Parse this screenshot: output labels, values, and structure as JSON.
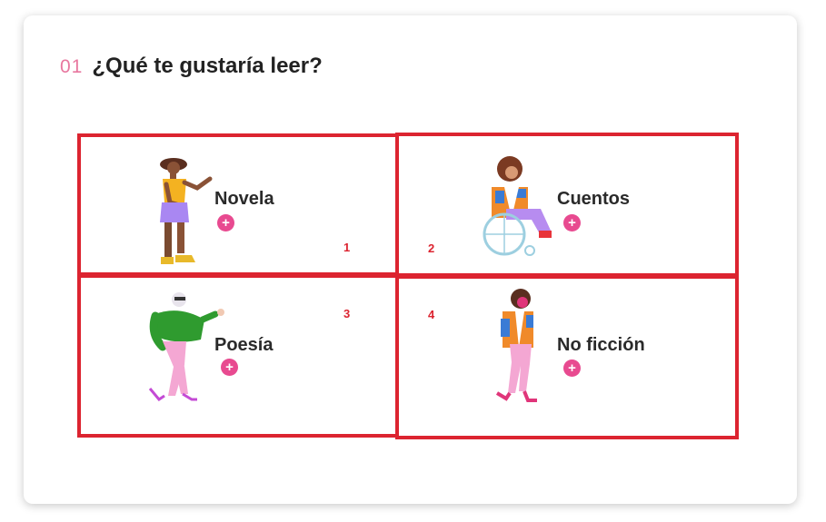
{
  "question": {
    "number": "01",
    "text": "¿Qué te gustaría leer?"
  },
  "options": [
    {
      "label": "Novela",
      "plus": "+",
      "marker": "1",
      "illustration": "woman-pointing-illustration"
    },
    {
      "label": "Cuentos",
      "plus": "+",
      "marker": "2",
      "illustration": "woman-wheelchair-illustration"
    },
    {
      "label": "Poesía",
      "plus": "+",
      "marker": "3",
      "illustration": "man-dancing-illustration"
    },
    {
      "label": "No ficción",
      "plus": "+",
      "marker": "4",
      "illustration": "woman-walking-illustration"
    }
  ],
  "colors": {
    "accent": "#e84a90",
    "number": "#e8779f",
    "highlight_border": "#dc2430",
    "title": "#222222"
  }
}
